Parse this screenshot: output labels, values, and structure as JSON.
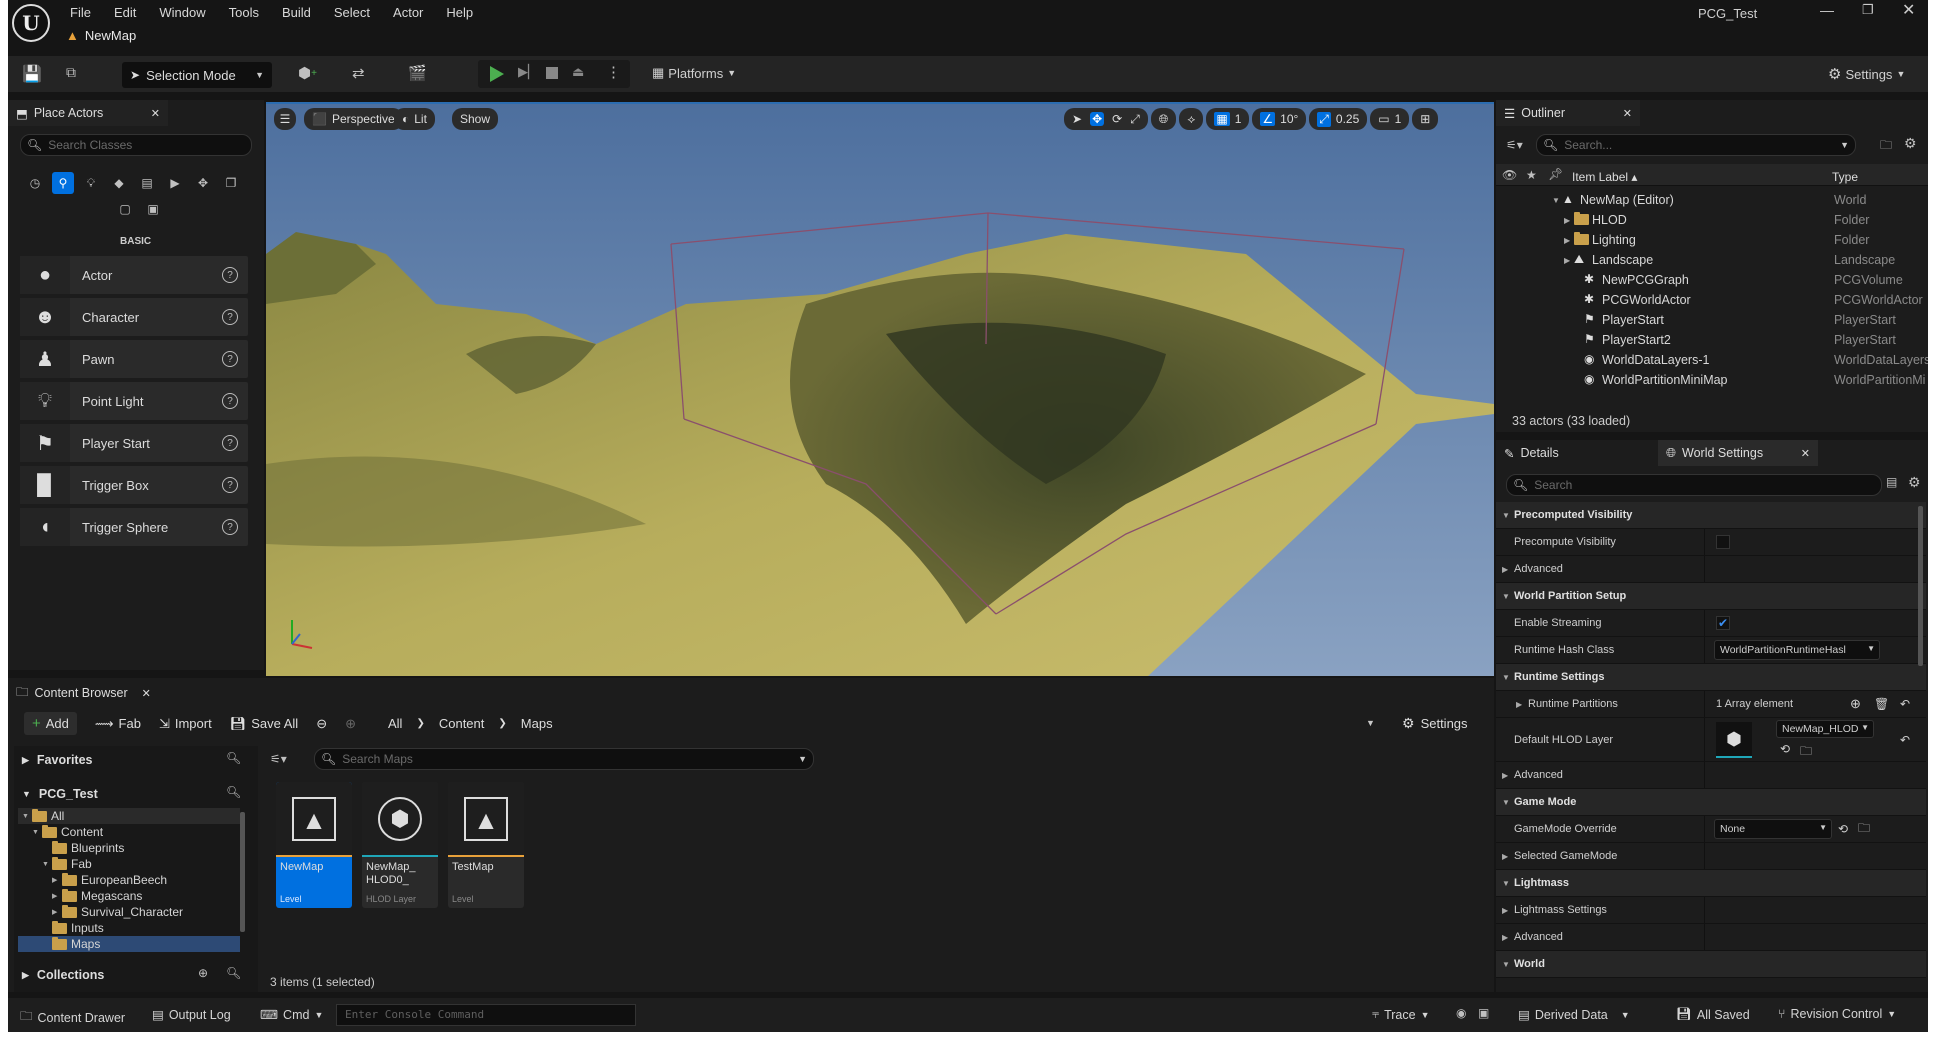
{
  "menu": [
    "File",
    "Edit",
    "Window",
    "Tools",
    "Build",
    "Select",
    "Actor",
    "Help"
  ],
  "project_name": "PCG_Test",
  "map_tab": "NewMap",
  "toolbar": {
    "mode": "Selection Mode",
    "platforms": "Platforms",
    "settings": "Settings"
  },
  "place_actors": {
    "title": "Place Actors",
    "search_placeholder": "Search Classes",
    "category": "BASIC",
    "items": [
      "Actor",
      "Character",
      "Pawn",
      "Point Light",
      "Player Start",
      "Trigger Box",
      "Trigger Sphere"
    ]
  },
  "viewport": {
    "perspective": "Perspective",
    "lit": "Lit",
    "show": "Show",
    "snap_grid": "1",
    "snap_angle": "10°",
    "snap_scale": "0.25",
    "camera_speed": "1"
  },
  "outliner": {
    "title": "Outliner",
    "search_placeholder": "Search...",
    "col_label": "Item Label ▴",
    "col_type": "Type",
    "rows": [
      {
        "label": "NewMap (Editor)",
        "type": "World"
      },
      {
        "label": "HLOD",
        "type": "Folder"
      },
      {
        "label": "Lighting",
        "type": "Folder"
      },
      {
        "label": "Landscape",
        "type": "Landscape"
      },
      {
        "label": "NewPCGGraph",
        "type": "PCGVolume"
      },
      {
        "label": "PCGWorldActor",
        "type": "PCGWorldActor"
      },
      {
        "label": "PlayerStart",
        "type": "PlayerStart"
      },
      {
        "label": "PlayerStart2",
        "type": "PlayerStart"
      },
      {
        "label": "WorldDataLayers-1",
        "type": "WorldDataLayers"
      },
      {
        "label": "WorldPartitionMiniMap",
        "type": "WorldPartitionMi"
      }
    ],
    "count": "33 actors (33 loaded)"
  },
  "details": {
    "tab_details": "Details",
    "tab_world": "World Settings",
    "search_placeholder": "Search",
    "rows": [
      {
        "label": "Precomputed Visibility",
        "cat": true
      },
      {
        "label": "Precompute Visibility",
        "cat": false
      },
      {
        "label": "Advanced",
        "cat": false
      },
      {
        "label": "World Partition Setup",
        "cat": true
      },
      {
        "label": "Enable Streaming",
        "cat": false
      },
      {
        "label": "Runtime Hash Class",
        "cat": false,
        "value": "WorldPartitionRuntimeHasl"
      },
      {
        "label": "Runtime Settings",
        "cat": true
      },
      {
        "label": "Runtime Partitions",
        "cat": false,
        "value": "1 Array element"
      },
      {
        "label": "Default HLOD Layer",
        "cat": false,
        "value": "NewMap_HLOD"
      },
      {
        "label": "Advanced",
        "cat": false
      },
      {
        "label": "Game Mode",
        "cat": true
      },
      {
        "label": "GameMode Override",
        "cat": false,
        "value": "None"
      },
      {
        "label": "Selected GameMode",
        "cat": false
      },
      {
        "label": "Lightmass",
        "cat": true
      },
      {
        "label": "Lightmass Settings",
        "cat": false
      },
      {
        "label": "Advanced",
        "cat": false
      },
      {
        "label": "World",
        "cat": true
      }
    ]
  },
  "content_browser": {
    "title": "Content Browser",
    "add": "Add",
    "fab": "Fab",
    "import": "Import",
    "save_all": "Save All",
    "path": [
      "All",
      "Content",
      "Maps"
    ],
    "settings": "Settings",
    "favorites": "Favorites",
    "project": "PCG_Test",
    "tree": [
      "All",
      "Content",
      "Blueprints",
      "Fab",
      "EuropeanBeech",
      "Megascans",
      "Survival_Character",
      "Inputs",
      "Maps"
    ],
    "collections": "Collections",
    "search_placeholder": "Search Maps",
    "assets": [
      {
        "name": "NewMap",
        "kind": "Level"
      },
      {
        "name": "NewMap_ HLOD0_",
        "kind": "HLOD Layer"
      },
      {
        "name": "TestMap",
        "kind": "Level"
      }
    ],
    "status": "3 items (1 selected)"
  },
  "statusbar": {
    "content_drawer": "Content Drawer",
    "output_log": "Output Log",
    "cmd": "Cmd",
    "console_placeholder": "Enter Console Command",
    "trace": "Trace",
    "derived_data": "Derived Data",
    "all_saved": "All Saved",
    "revision": "Revision Control"
  },
  "colors": {
    "accent": "#0070e0",
    "play": "#4caf50",
    "folder": "#c9a04b"
  }
}
